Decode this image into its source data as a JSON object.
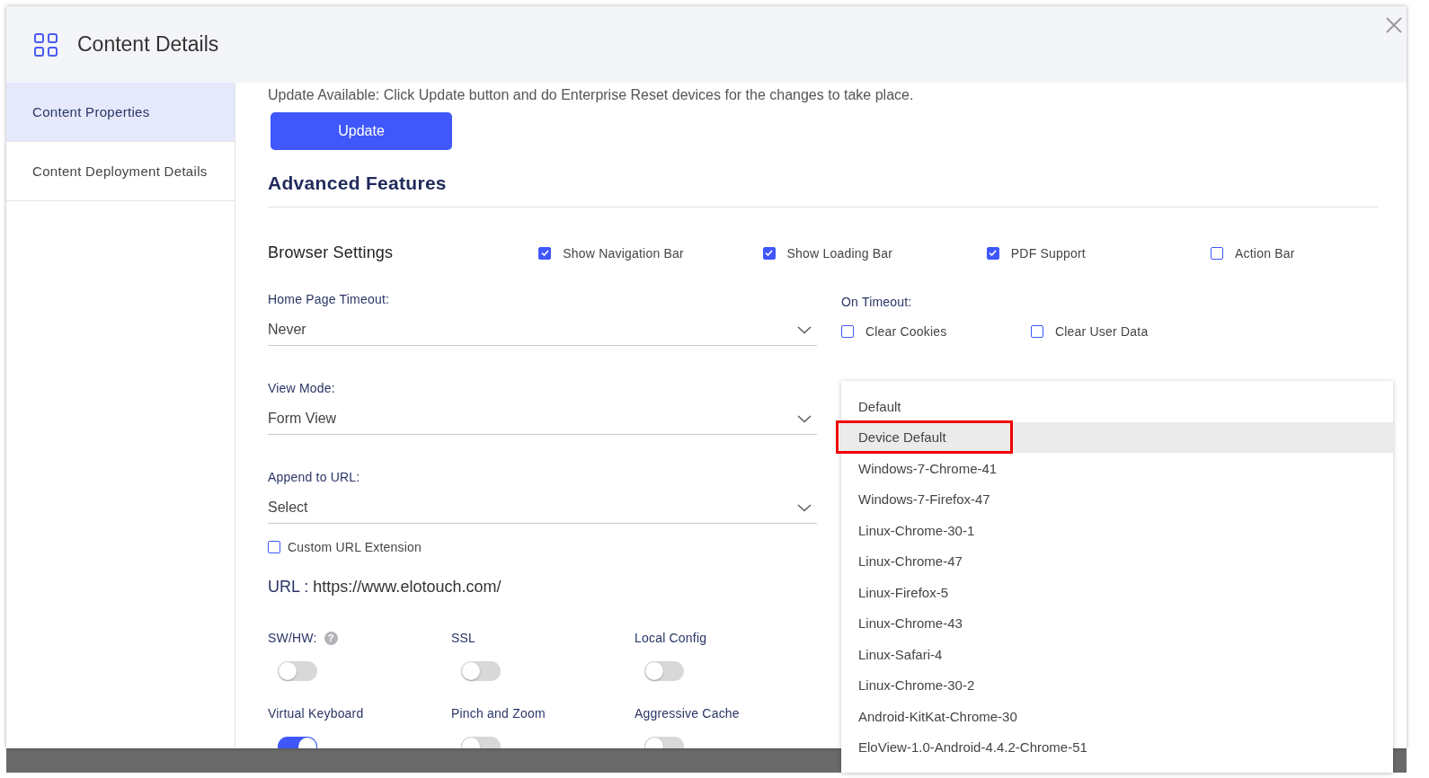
{
  "dialog": {
    "title": "Content Details"
  },
  "sidebar": {
    "items": [
      {
        "label": "Content Properties",
        "selected": true
      },
      {
        "label": "Content Deployment Details",
        "selected": false
      }
    ]
  },
  "notice": "Update Available: Click Update button and do Enterprise Reset devices for the changes to take place.",
  "update_button": "Update",
  "section_title": "Advanced Features",
  "browser_settings": {
    "title": "Browser Settings",
    "options": [
      {
        "label": "Show Navigation Bar",
        "checked": true
      },
      {
        "label": "Show Loading Bar",
        "checked": true
      },
      {
        "label": "PDF Support",
        "checked": true
      },
      {
        "label": "Action Bar",
        "checked": false
      }
    ]
  },
  "fields": [
    {
      "label": "Home Page Timeout:",
      "value": "Never"
    },
    {
      "label": "View Mode:",
      "value": "Form View"
    },
    {
      "label": "Append to URL:",
      "value": "Select"
    }
  ],
  "on_timeout": {
    "label": "On Timeout:",
    "options": [
      {
        "label": "Clear Cookies",
        "checked": false
      },
      {
        "label": "Clear User Data",
        "checked": false
      }
    ]
  },
  "custom_url_extension": {
    "label": "Custom URL Extension",
    "checked": false
  },
  "url": {
    "label": "URL :",
    "value": "https://www.elotouch.com/"
  },
  "toggles": [
    {
      "label": "SW/HW:",
      "help": "?",
      "on": false
    },
    {
      "label": "SSL",
      "on": false
    },
    {
      "label": "Local Config",
      "on": false
    },
    {
      "label": "Virtual Keyboard",
      "on": true
    },
    {
      "label": "Pinch and Zoom",
      "on": false
    },
    {
      "label": "Aggressive Cache",
      "on": false
    }
  ],
  "web_view_dropdown": {
    "options": [
      {
        "label": "Default",
        "selected": false,
        "outlined": false
      },
      {
        "label": "Device Default",
        "selected": true,
        "outlined": true
      },
      {
        "label": "Windows-7-Chrome-41",
        "selected": false,
        "outlined": false
      },
      {
        "label": "Windows-7-Firefox-47",
        "selected": false,
        "outlined": false
      },
      {
        "label": "Linux-Chrome-30-1",
        "selected": false,
        "outlined": false
      },
      {
        "label": "Linux-Chrome-47",
        "selected": false,
        "outlined": false
      },
      {
        "label": "Linux-Firefox-5",
        "selected": false,
        "outlined": false
      },
      {
        "label": "Linux-Chrome-43",
        "selected": false,
        "outlined": false
      },
      {
        "label": "Linux-Safari-4",
        "selected": false,
        "outlined": false
      },
      {
        "label": "Linux-Chrome-30-2",
        "selected": false,
        "outlined": false
      },
      {
        "label": "Android-KitKat-Chrome-30",
        "selected": false,
        "outlined": false
      },
      {
        "label": "EloView-1.0-Android-4.4.2-Chrome-51",
        "selected": false,
        "outlined": false
      }
    ]
  }
}
